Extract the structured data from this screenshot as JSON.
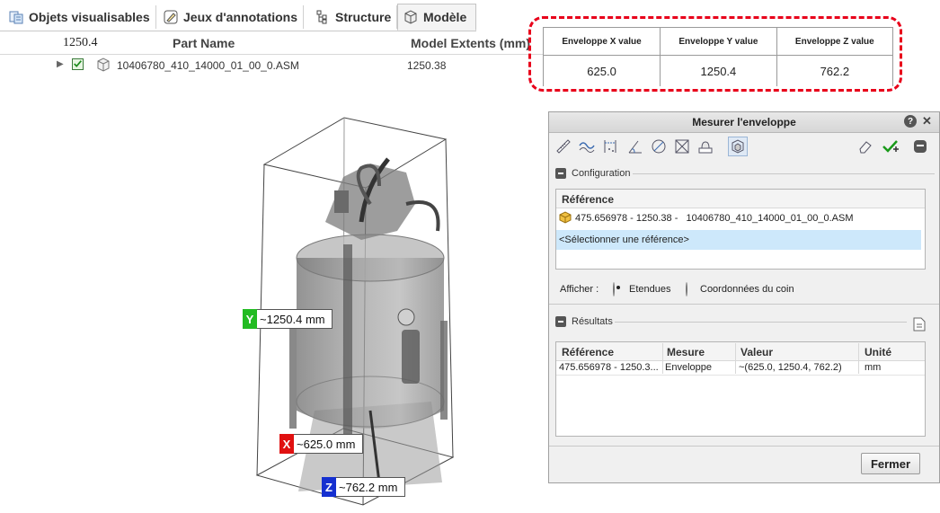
{
  "tabs": [
    {
      "label": "Objets visualisables",
      "icon": "visualizable-objects-icon"
    },
    {
      "label": "Jeux d'annotations",
      "icon": "annotation-sets-icon"
    },
    {
      "label": "Structure",
      "icon": "structure-icon"
    },
    {
      "label": "Modèle",
      "icon": "model-icon",
      "active": true
    }
  ],
  "tree_table": {
    "col0_value": "1250.4",
    "columns": [
      "Part Name",
      "Model Extents (mm)"
    ],
    "row": {
      "part_name": "10406780_410_14000_01_00_0.ASM",
      "model_extents": "1250.38"
    }
  },
  "envelope_summary": {
    "headers": [
      "Enveloppe X value",
      "Enveloppe Y value",
      "Enveloppe Z value"
    ],
    "values": [
      "625.0",
      "1250.4",
      "762.2"
    ],
    "highlight_color": "#e8001a"
  },
  "viewport": {
    "dims": [
      {
        "axis": "Y",
        "value": "~1250.4 mm",
        "color": "#22bb22"
      },
      {
        "axis": "X",
        "value": "~625.0 mm",
        "color": "#e01010"
      },
      {
        "axis": "Z",
        "value": "~762.2 mm",
        "color": "#1530d0"
      }
    ]
  },
  "dialog": {
    "title": "Mesurer l'enveloppe",
    "help": "?",
    "close": "✕",
    "configuration": {
      "title": "Configuration",
      "ref_header": "Référence",
      "ref_item": "475.656978 - 1250.38 -   10406780_410_14000_01_00_0.ASM",
      "select_prompt": "<Sélectionner une référence>",
      "display_label": "Afficher :",
      "options": [
        "Etendues",
        "Coordonnées du coin"
      ],
      "selected": "Etendues"
    },
    "results": {
      "title": "Résultats",
      "headers": [
        "Référence",
        "Mesure",
        "Valeur",
        "Unité"
      ],
      "row": [
        "475.656978 - 1250.3...",
        "Enveloppe",
        "~(625.0, 1250.4, 762.2)",
        "mm"
      ]
    },
    "close_button": "Fermer"
  }
}
